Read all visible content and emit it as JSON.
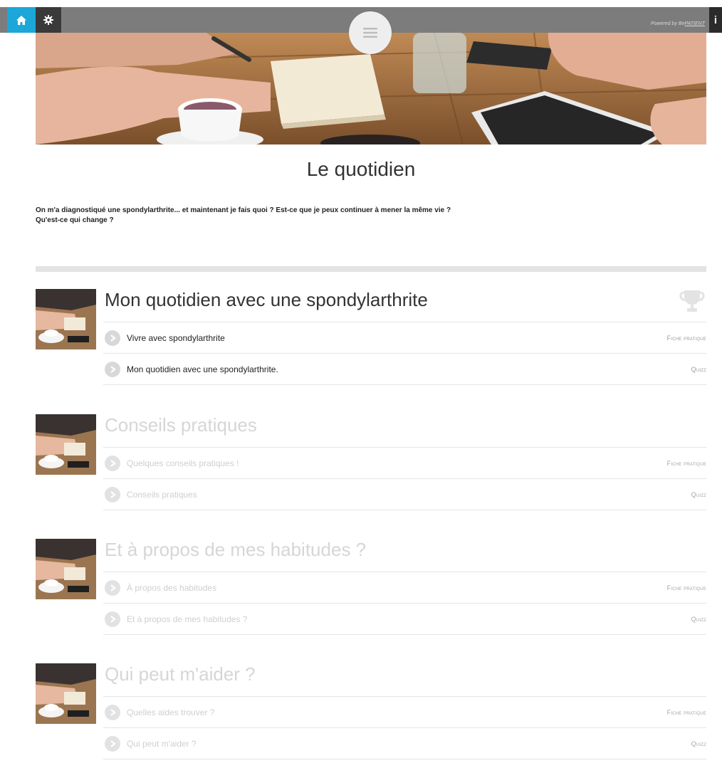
{
  "header": {
    "home_icon": "home-icon",
    "settings_icon": "gear-icon",
    "menu_icon": "hamburger-icon",
    "info_icon": "info-icon",
    "powered_by_prefix": "Powered by Be",
    "powered_by_brand": "PATIENT",
    "accent_color": "#1ba7d8"
  },
  "page": {
    "title": "Le quotidien",
    "intro_line1": "On m'a diagnostiqué une spondylarthrite... et maintenant je fais quoi ? Est-ce que je peux continuer à mener la même vie ?",
    "intro_line2": "Qu'est-ce qui change ?"
  },
  "modules": [
    {
      "title": "Mon quotidien avec une spondylarthrite",
      "locked": false,
      "items": [
        {
          "label": "Vivre avec spondylarthrite",
          "type": "Fiche pratique"
        },
        {
          "label": "Mon quotidien avec une spondylarthrite.",
          "type": "Quizz"
        }
      ]
    },
    {
      "title": "Conseils pratiques",
      "locked": true,
      "items": [
        {
          "label": "Quelques conseils pratiques !",
          "type": "Fiche pratique"
        },
        {
          "label": "Conseils pratiques",
          "type": "Quizz"
        }
      ]
    },
    {
      "title": "Et à propos de mes habitudes ?",
      "locked": true,
      "items": [
        {
          "label": "À propos des habitudes",
          "type": "Fiche pratique"
        },
        {
          "label": "Et à propos de mes habitudes ?",
          "type": "Quizz"
        }
      ]
    },
    {
      "title": "Qui peut m'aider ?",
      "locked": true,
      "items": [
        {
          "label": "Quelles aides trouver ?",
          "type": "Fiche pratique"
        },
        {
          "label": "Qui peut m'aider ?",
          "type": "Quizz"
        }
      ]
    }
  ]
}
